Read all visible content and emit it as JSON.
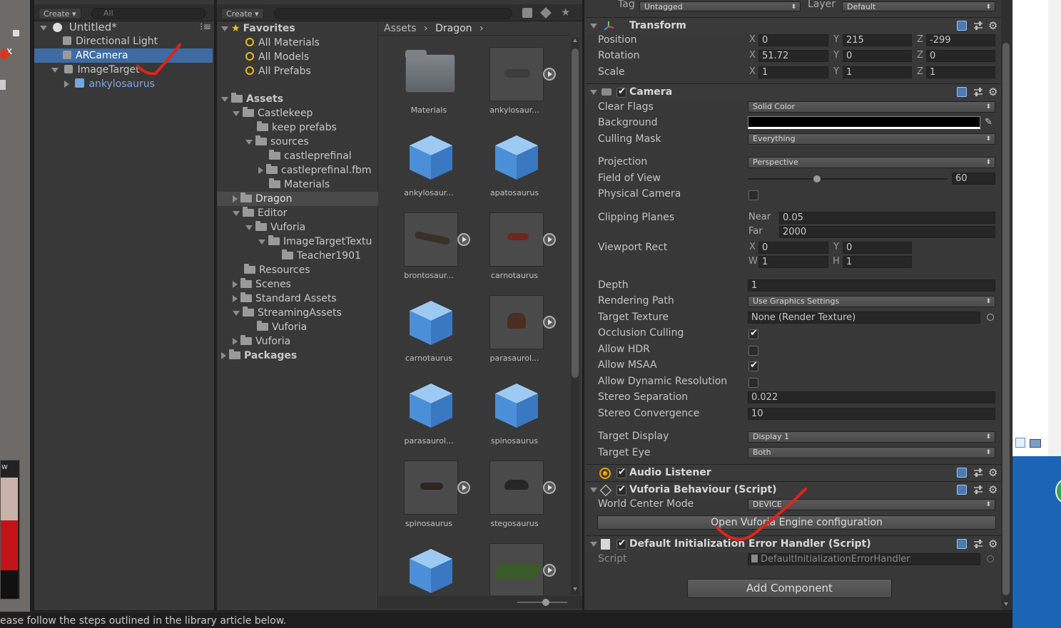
{
  "hierarchy": {
    "create_label": "Create",
    "search_placeholder": "All",
    "scene_name": "Untitled*",
    "items": [
      {
        "label": "Directional Light"
      },
      {
        "label": "ARCamera"
      },
      {
        "label": "ImageTarget"
      },
      {
        "label": "ankylosaurus"
      }
    ]
  },
  "project": {
    "create_label": "Create",
    "breadcrumb": [
      "Assets",
      "Dragon"
    ],
    "favorites_label": "Favorites",
    "favorites": [
      "All Materials",
      "All Models",
      "All Prefabs"
    ],
    "tree": [
      {
        "label": "Assets"
      },
      {
        "label": "Castlekeep"
      },
      {
        "label": "keep prefabs"
      },
      {
        "label": "sources"
      },
      {
        "label": "castleprefinal"
      },
      {
        "label": "castleprefinal.fbm"
      },
      {
        "label": "Materials"
      },
      {
        "label": "Dragon"
      },
      {
        "label": "Editor"
      },
      {
        "label": "Vuforia"
      },
      {
        "label": "ImageTargetTextu"
      },
      {
        "label": "Teacher1901"
      },
      {
        "label": "Resources"
      },
      {
        "label": "Scenes"
      },
      {
        "label": "Standard Assets"
      },
      {
        "label": "StreamingAssets"
      },
      {
        "label": "Vuforia"
      },
      {
        "label": "Vuforia"
      },
      {
        "label": "Packages"
      }
    ],
    "assets": [
      {
        "label": "Materials"
      },
      {
        "label": "ankylosaur..."
      },
      {
        "label": "ankylosaur..."
      },
      {
        "label": "apatosaurus"
      },
      {
        "label": "brontosaur..."
      },
      {
        "label": "carnotaurus"
      },
      {
        "label": "carnotaurus"
      },
      {
        "label": "parasaurol..."
      },
      {
        "label": "parasaurol..."
      },
      {
        "label": "spinosaurus"
      },
      {
        "label": "spinosaurus"
      },
      {
        "label": "stegosaurus"
      }
    ]
  },
  "inspector": {
    "tag_label": "Tag",
    "tag_value": "Untagged",
    "layer_label": "Layer",
    "layer_value": "Default",
    "transform": {
      "title": "Transform",
      "position_label": "Position",
      "rotation_label": "Rotation",
      "scale_label": "Scale",
      "position": [
        "0",
        "215",
        "-299"
      ],
      "rotation": [
        "51.72",
        "0",
        "0"
      ],
      "scale": [
        "1",
        "1",
        "1"
      ],
      "axes": [
        "X",
        "Y",
        "Z"
      ]
    },
    "camera": {
      "title": "Camera",
      "clear_flags_label": "Clear Flags",
      "clear_flags": "Solid Color",
      "background_label": "Background",
      "background_color": "#000000",
      "culling_mask_label": "Culling Mask",
      "culling_mask": "Everything",
      "projection_label": "Projection",
      "projection": "Perspective",
      "fov_label": "Field of View",
      "fov": "60",
      "fov_fraction": 0.34,
      "physical_camera_label": "Physical Camera",
      "clipping_label": "Clipping Planes",
      "near_label": "Near",
      "near": "0.05",
      "far_label": "Far",
      "far": "2000",
      "viewport_label": "Viewport Rect",
      "vp_x_label": "X",
      "vp_x": "0",
      "vp_y_label": "Y",
      "vp_y": "0",
      "vp_w_label": "W",
      "vp_w": "1",
      "vp_h_label": "H",
      "vp_h": "1",
      "depth_label": "Depth",
      "depth": "1",
      "rendering_path_label": "Rendering Path",
      "rendering_path": "Use Graphics Settings",
      "target_texture_label": "Target Texture",
      "target_texture": "None (Render Texture)",
      "occlusion_label": "Occlusion Culling",
      "hdr_label": "Allow HDR",
      "msaa_label": "Allow MSAA",
      "dynres_label": "Allow Dynamic Resolution",
      "stereo_sep_label": "Stereo Separation",
      "stereo_sep": "0.022",
      "stereo_conv_label": "Stereo Convergence",
      "stereo_conv": "10",
      "target_display_label": "Target Display",
      "target_display": "Display 1",
      "target_eye_label": "Target Eye",
      "target_eye": "Both"
    },
    "audio_listener": {
      "title": "Audio Listener"
    },
    "vuforia": {
      "title": "Vuforia Behaviour (Script)",
      "world_center_label": "World Center Mode",
      "world_center": "DEVICE",
      "open_config_label": "Open Vuforia Engine configuration"
    },
    "default_handler": {
      "title": "Default Initialization Error Handler (Script)",
      "script_label": "Script",
      "script_value": "DefaultInitializationErrorHandler"
    },
    "add_component_label": "Add Component"
  },
  "status_bar": {
    "text": "ease follow the steps outlined in the library article below."
  },
  "side_panel": {
    "label": "w"
  },
  "colors": {
    "selection": "#3e6ba3",
    "annotation": "#e0241a",
    "prefab_text": "#7fa6e8"
  }
}
